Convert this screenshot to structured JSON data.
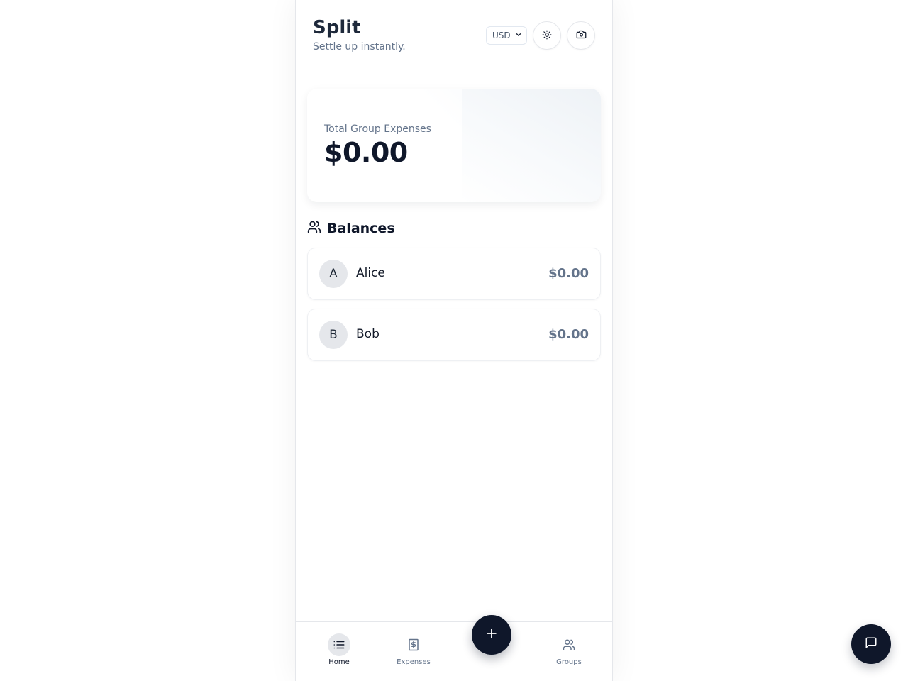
{
  "app": {
    "title": "Split",
    "subtitle": "Settle up instantly."
  },
  "header": {
    "currency": {
      "selected": "USD"
    },
    "theme_toggle_icon": "sun-icon",
    "camera_icon": "camera-icon"
  },
  "summary": {
    "label": "Total Group Expenses",
    "amount": "$0.00"
  },
  "balances": {
    "title": "Balances",
    "icon": "users-icon",
    "people": [
      {
        "initial": "A",
        "name": "Alice",
        "amount": "$0.00"
      },
      {
        "initial": "B",
        "name": "Bob",
        "amount": "$0.00"
      }
    ]
  },
  "nav": {
    "items": [
      {
        "label": "Home",
        "icon": "list-icon",
        "active": true
      },
      {
        "label": "Expenses",
        "icon": "receipt-dollar-icon",
        "active": false
      },
      {
        "label": "Groups",
        "icon": "users-icon",
        "active": false
      }
    ],
    "fab_icon": "plus-icon"
  },
  "chat": {
    "icon": "message-square-icon"
  },
  "colors": {
    "primary": "#0f172a",
    "muted": "#64748b",
    "avatar_bg": "#e5e7eb"
  }
}
